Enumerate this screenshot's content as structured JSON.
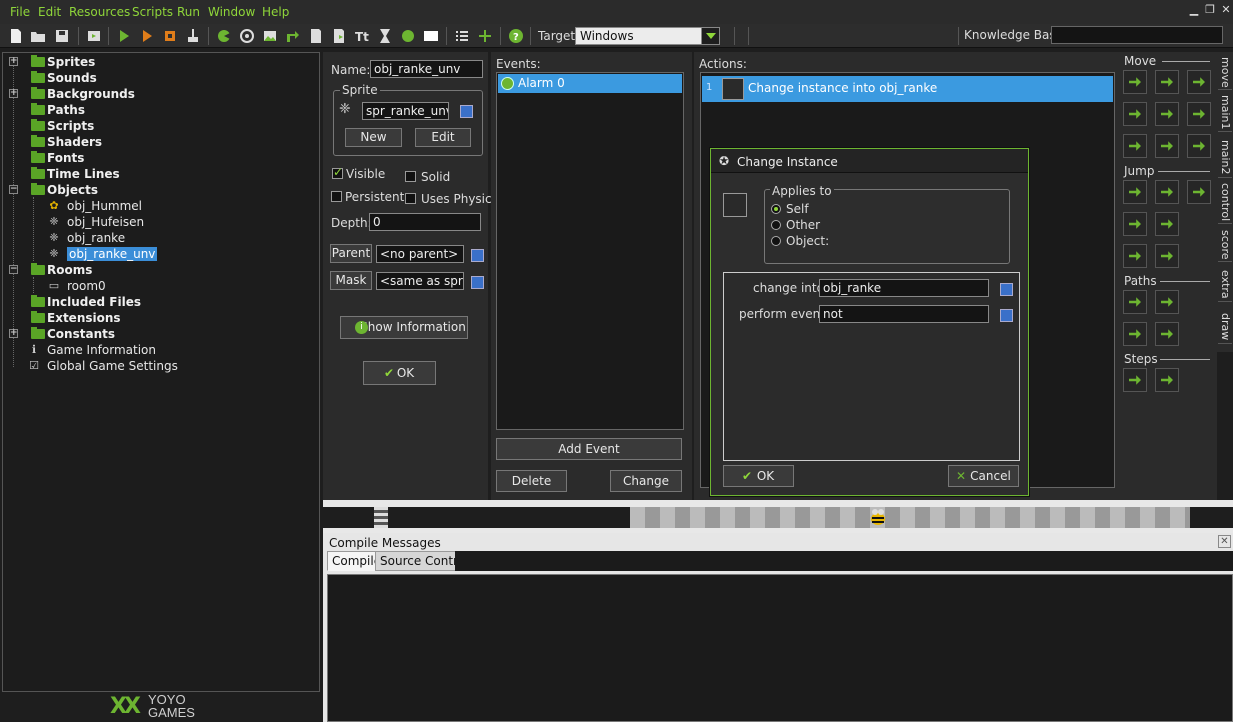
{
  "menu": [
    "File",
    "Edit",
    "Resources",
    "Scripts",
    "Run",
    "Window",
    "Help"
  ],
  "toolbar": {
    "target_label": "Target:",
    "target_value": "Windows",
    "knowledge_base_label": "Knowledge Base:"
  },
  "tree": {
    "items": [
      {
        "label": "Sprites"
      },
      {
        "label": "Sounds"
      },
      {
        "label": "Backgrounds"
      },
      {
        "label": "Paths"
      },
      {
        "label": "Scripts"
      },
      {
        "label": "Shaders"
      },
      {
        "label": "Fonts"
      },
      {
        "label": "Time Lines"
      },
      {
        "label": "Objects"
      },
      {
        "label": "obj_Hummel"
      },
      {
        "label": "obj_Hufeisen"
      },
      {
        "label": "obj_ranke"
      },
      {
        "label": "obj_ranke_unv"
      },
      {
        "label": "Rooms"
      },
      {
        "label": "room0"
      },
      {
        "label": "Included Files"
      },
      {
        "label": "Extensions"
      },
      {
        "label": "Constants"
      },
      {
        "label": "Game Information"
      },
      {
        "label": "Global Game Settings"
      }
    ]
  },
  "logo": {
    "top": "YOYO",
    "bottom": "GAMES"
  },
  "object": {
    "name_label": "Name:",
    "name_value": "obj_ranke_unv",
    "sprite_group": "Sprite",
    "sprite_value": "spr_ranke_unver",
    "new_label": "New",
    "edit_label": "Edit",
    "visible_label": "Visible",
    "solid_label": "Solid",
    "persistent_label": "Persistent",
    "physics_label": "Uses Physics",
    "depth_label": "Depth:",
    "depth_value": "0",
    "parent_label": "Parent",
    "parent_value": "<no parent>",
    "mask_label": "Mask",
    "mask_value": "<same as sprite>",
    "show_info_label": "Show Information",
    "ok_label": "OK"
  },
  "events": {
    "title": "Events:",
    "items": [
      "Alarm 0"
    ],
    "add_label": "Add Event",
    "delete_label": "Delete",
    "change_label": "Change"
  },
  "actions": {
    "title": "Actions:",
    "items": [
      {
        "num": "1",
        "text": "Change instance into obj_ranke"
      }
    ]
  },
  "library": {
    "move": "Move",
    "jump": "Jump",
    "paths": "Paths",
    "steps": "Steps",
    "tabs": [
      "move",
      "main1",
      "main2",
      "control",
      "score",
      "extra",
      "draw"
    ]
  },
  "dialog": {
    "title": "Change Instance",
    "applies_to": "Applies to",
    "options": [
      "Self",
      "Other",
      "Object:"
    ],
    "change_into_label": "change into:",
    "change_into_value": "obj_ranke",
    "perform_events_label": "perform events:",
    "perform_events_value": "not",
    "ok_label": "OK",
    "cancel_label": "Cancel"
  },
  "compile": {
    "title": "Compile Messages",
    "tabs": [
      "Compile",
      "Source Control"
    ]
  },
  "colors": {
    "accent": "#6db531",
    "selection": "#3b9ae0"
  }
}
